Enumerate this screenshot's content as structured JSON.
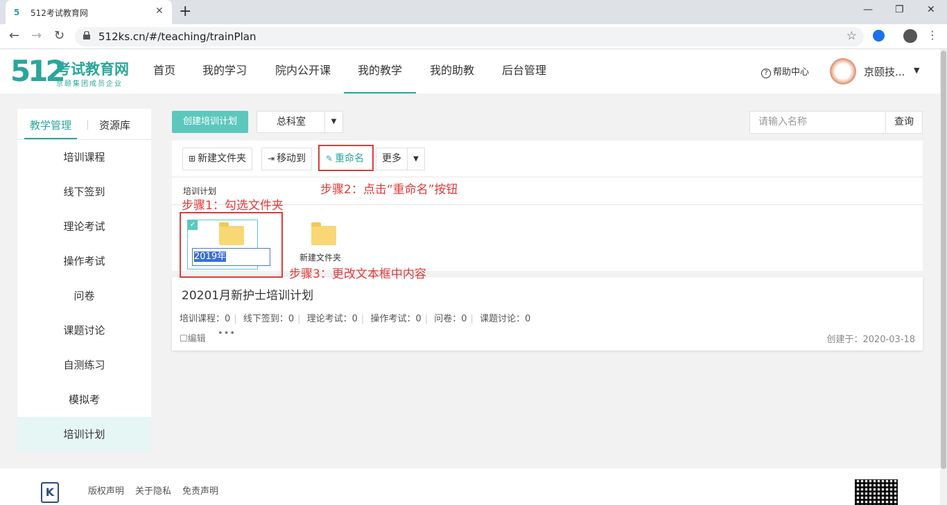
{
  "browser": {
    "tab_title": "512考试教育网",
    "url": "512ks.cn/#/teaching/trainPlan"
  },
  "header": {
    "logo_mark": "512",
    "logo_name": "考试教育网",
    "logo_slogan": "京颐集团成员企业",
    "nav": [
      {
        "label": "首页"
      },
      {
        "label": "我的学习"
      },
      {
        "label": "院内公开课"
      },
      {
        "label": "我的教学",
        "active": true
      },
      {
        "label": "我的助教"
      },
      {
        "label": "后台管理"
      }
    ],
    "help": "帮助中心",
    "username": "京颐技..."
  },
  "sidebar": {
    "tabs": [
      {
        "label": "教学管理",
        "active": true
      },
      {
        "label": "资源库"
      }
    ],
    "items": [
      {
        "label": "培训课程"
      },
      {
        "label": "线下签到"
      },
      {
        "label": "理论考试"
      },
      {
        "label": "操作考试"
      },
      {
        "label": "问卷"
      },
      {
        "label": "课题讨论"
      },
      {
        "label": "自测练习"
      },
      {
        "label": "模拟考"
      },
      {
        "label": "培训计划",
        "active": true
      }
    ]
  },
  "toolbar": {
    "create_label": "创建培训计划",
    "department": "总科室",
    "search_placeholder": "请输入名称",
    "search_label": "查询",
    "new_folder_label": "新建文件夹",
    "move_to_label": "移动到",
    "rename_label": "重命名",
    "more_label": "更多"
  },
  "breadcrumb": "培训计划",
  "folders": [
    {
      "name": "2019年",
      "selected": true,
      "editing": true
    },
    {
      "name": "新建文件夹",
      "selected": false
    }
  ],
  "plan": {
    "title": "20201月新护士培训计划",
    "stats": [
      "培训课程：0",
      "线下签到：0",
      "理论考试：0",
      "操作考试：0",
      "问卷：0",
      "课题讨论：0"
    ],
    "edit_label": "编辑",
    "more_label": "•••",
    "created": "创建于：2020-03-18"
  },
  "annotations": {
    "step1": "步骤1：勾选文件夹",
    "step2": "步骤2：点击“重命名”按钮",
    "step3": "步骤3：更改文本框中内容"
  },
  "footer": {
    "logo_mark": "K",
    "links": [
      "版权声明",
      "关于隐私",
      "免责声明"
    ]
  },
  "colors": {
    "accent": "#2aa69a",
    "button_teal": "#5cc8bd",
    "annotation_red": "#e03a3a",
    "active_bg": "#e5f6f4"
  }
}
